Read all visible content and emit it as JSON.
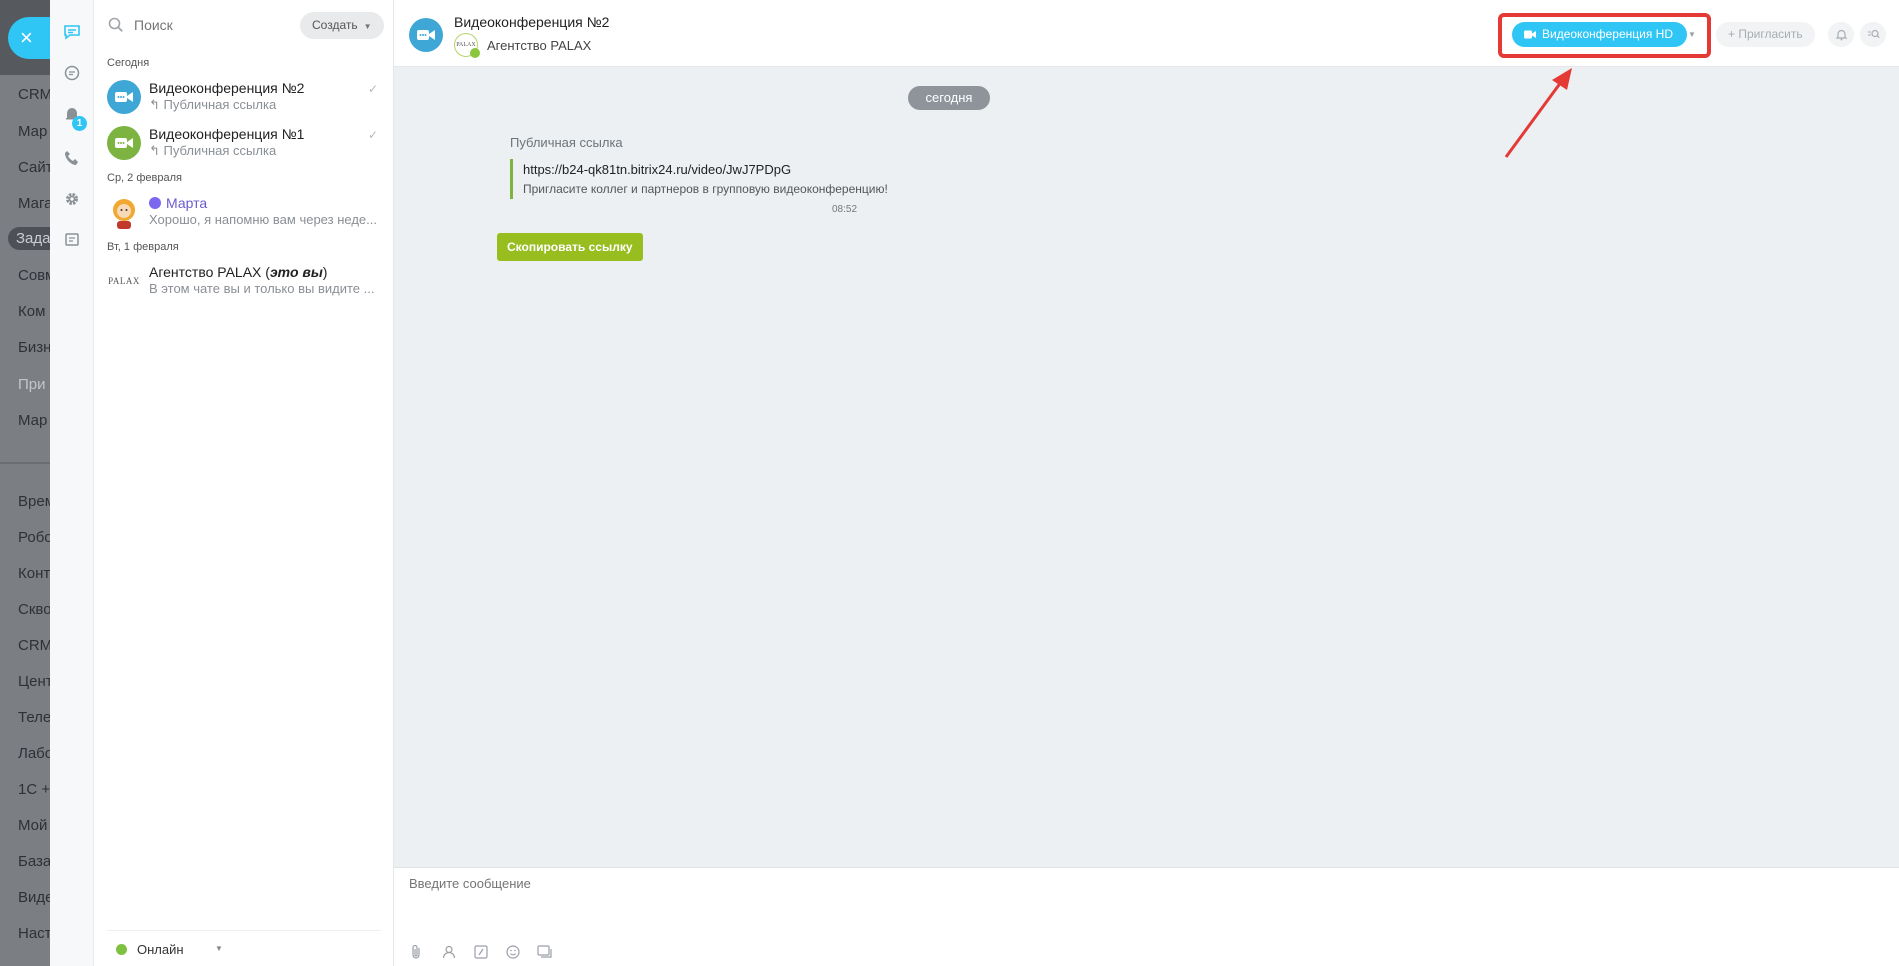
{
  "background_menu": {
    "items": [
      "CRM",
      "Мар",
      "Сайт",
      "Мага",
      "Зада",
      "Совм",
      "Ком",
      "Бизн",
      "При",
      "Мар",
      "Врем",
      "Робо",
      "Конт",
      "Скво",
      "CRM",
      "Цент",
      "Теле",
      "Лабо",
      "1С +",
      "Мой",
      "База",
      "Виде",
      "Наст"
    ]
  },
  "recent": {
    "search_placeholder": "Поиск",
    "create_label": "Создать",
    "groups": {
      "today": "Сегодня",
      "wed": "Ср, 2 февраля",
      "tue": "Вт, 1 февраля"
    },
    "items": [
      {
        "title": "Видеоконференция №2",
        "subtitle": "↰ Публичная ссылка",
        "color": "#3fa7d5"
      },
      {
        "title": "Видеоконференция №1",
        "subtitle": "↰ Публичная ссылка",
        "color": "#7cb341"
      },
      {
        "title": "Марта",
        "subtitle": "Хорошо, я напомню вам через неде..."
      },
      {
        "title": "Агентство PALAX",
        "title_suffix": "это вы",
        "subtitle": "В этом чате вы и только вы видите ...",
        "avatar_text": "PALAX"
      }
    ],
    "status": "Онлайн",
    "badge": "1"
  },
  "chat": {
    "title": "Видеоконференция №2",
    "owner": "Агентство PALAX",
    "owner_avatar": "PALAX",
    "hd_button": "Видеоконференция HD",
    "invite_button": "+ Пригласить",
    "date_pill": "сегодня",
    "message": {
      "label": "Публичная ссылка",
      "link": "https://b24-qk81tn.bitrix24.ru/video/JwJ7PDpG",
      "description": "Пригласите коллег и партнеров в групповую видеоконференцию!",
      "time": "08:52"
    },
    "copy_button": "Скопировать ссылку",
    "composer_placeholder": "Введите сообщение"
  },
  "colors": {
    "accent": "#2fc6f6",
    "highlight": "#e53935",
    "copy_button": "#97bd1f",
    "online": "#7ec141"
  }
}
